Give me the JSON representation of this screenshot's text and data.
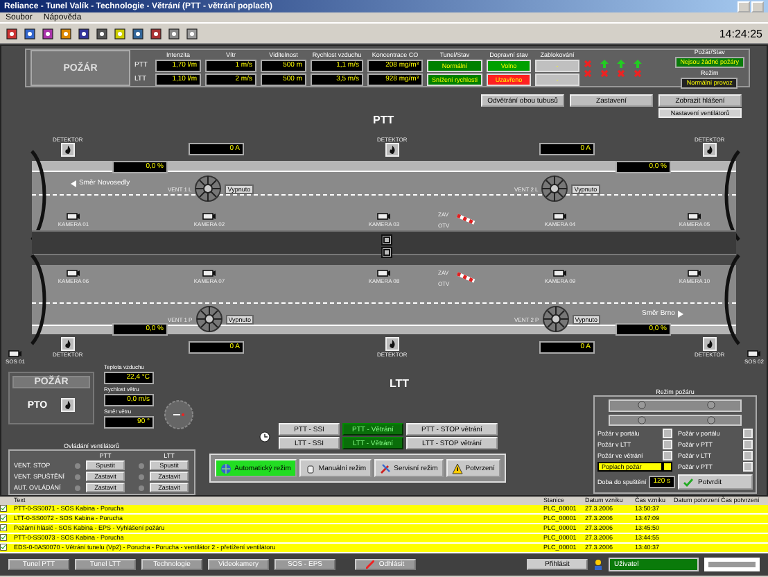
{
  "window": {
    "title": "Reliance - Tunel Valík - Technologie - Větrání (PTT - větrání poplach)"
  },
  "menu": [
    "Soubor",
    "Nápověda"
  ],
  "toolbar": {
    "time": "14:24:25"
  },
  "status_panel": {
    "fire_label": "POŽÁR",
    "headers": [
      "Intenzita",
      "Vítr",
      "Viditelnost",
      "Rychlost vzduchu",
      "Koncentrace CO",
      "Tunel/Stav",
      "Dopravní stav",
      "Zablokování"
    ],
    "rows": [
      {
        "tube": "PTT",
        "cells": [
          {
            "kind": "display",
            "text": "1,70 l/m"
          },
          {
            "kind": "display",
            "text": "1 m/s"
          },
          {
            "kind": "display",
            "text": "500 m"
          },
          {
            "kind": "display",
            "text": "1,1 m/s"
          },
          {
            "kind": "display",
            "text": "208 mg/m³"
          },
          {
            "kind": "status",
            "text": "Normální",
            "color": "#008000"
          },
          {
            "kind": "status",
            "text": "Volno",
            "color": "#00a000"
          },
          {
            "kind": "status",
            "text": "-",
            "color": "#c0c0c0"
          }
        ],
        "signals": [
          {
            "fault": true
          },
          {
            "fault": false
          },
          {
            "fault": false
          },
          {
            "fault": false
          }
        ]
      },
      {
        "tube": "LTT",
        "cells": [
          {
            "kind": "display",
            "text": "1,10 l/m"
          },
          {
            "kind": "display",
            "text": "2 m/s"
          },
          {
            "kind": "display",
            "text": "500 m"
          },
          {
            "kind": "display",
            "text": "3,5 m/s"
          },
          {
            "kind": "display",
            "text": "928 mg/m³"
          },
          {
            "kind": "status",
            "text": "Snížení rychlosti",
            "color": "#008000"
          },
          {
            "kind": "status",
            "text": "Uzavřeno",
            "color": "#ff2020"
          },
          {
            "kind": "status",
            "text": "-",
            "color": "#c0c0c0"
          }
        ],
        "signals": [
          {
            "fault": true
          },
          {
            "fault": true
          },
          {
            "fault": true
          },
          {
            "fault": true
          }
        ]
      }
    ],
    "fire_status": {
      "label": "Požár/Stav",
      "text": "Nejsou žádné požáry"
    },
    "mode": {
      "label": "Režim",
      "text": "Normální provoz"
    }
  },
  "actions": [
    "Odvětrání obou tubusů",
    "Zastavení",
    "Zobrazit hlášení",
    "Nastavení ventilátorů"
  ],
  "tunnels": [
    {
      "name": "PTT",
      "detectors": [
        "DETEKTOR",
        "DETEKTOR",
        "DETEKTOR"
      ],
      "currents": [
        "0 A",
        "0 A"
      ],
      "opacity": [
        "0,0 %",
        "0,0 %"
      ],
      "direction": "Směr Novosedly",
      "fans": [
        {
          "label": "VENT 1 L",
          "state": "Vypnuto"
        },
        {
          "label": "VENT 2 L",
          "state": "Vypnuto"
        }
      ],
      "cameras": [
        "KAMERA 01",
        "KAMERA 02",
        "KAMERA 03",
        "KAMERA 04",
        "KAMERA 05"
      ],
      "barrier_labels": [
        "ZAV",
        "OTV"
      ]
    },
    {
      "name": "LTT",
      "detectors": [
        "DETEKTOR",
        "DETEKTOR",
        "DETEKTOR"
      ],
      "currents": [
        "0 A",
        "0 A"
      ],
      "opacity": [
        "0,0 %",
        "0,0 %"
      ],
      "direction": "Směr Brno",
      "fans": [
        {
          "label": "VENT 1 P",
          "state": "Vypnuto"
        },
        {
          "label": "VENT 2 P",
          "state": "Vypnuto"
        }
      ],
      "cameras": [
        "KAMERA 06",
        "KAMERA 07",
        "KAMERA 08",
        "KAMERA 09",
        "KAMERA 10"
      ],
      "barrier_labels": [
        "ZAV",
        "OTV"
      ]
    }
  ],
  "exits": [
    "SOS 01",
    "SOS 02"
  ],
  "fire_box": {
    "title": "POŽÁR",
    "zone": "PTO"
  },
  "weather": [
    {
      "label": "Teplota vzduchu",
      "value": "22,4 °C"
    },
    {
      "label": "Rychlost větru",
      "value": "0,0 m/s"
    },
    {
      "label": "Směr větru",
      "value": "90 °"
    }
  ],
  "fan_control": {
    "title": "Ovládání ventilátorů",
    "columns": [
      "PTT",
      "LTT"
    ],
    "rows": [
      {
        "label": "VENT. STOP",
        "buttons": [
          "Spustit",
          "Spustit"
        ]
      },
      {
        "label": "VENT. SPUŠTĚNÍ",
        "buttons": [
          "Zastavit",
          "Zastavit"
        ]
      },
      {
        "label": "AUT. OVLÁDÁNÍ",
        "buttons": [
          "Zastavit",
          "Zastavit"
        ]
      }
    ]
  },
  "commands": [
    {
      "label": "PTT - SSI",
      "selected": false
    },
    {
      "label": "PTT - Větrání",
      "selected": true
    },
    {
      "label": "PTT - STOP větrání",
      "selected": false
    },
    {
      "label": "LTT - SSI",
      "selected": false
    },
    {
      "label": "LTT - Větrání",
      "selected": true
    },
    {
      "label": "LTT - STOP větrání",
      "selected": false
    }
  ],
  "modes": [
    {
      "label": "Automatický režim",
      "selected": true
    },
    {
      "label": "Manuální režim",
      "selected": false
    },
    {
      "label": "Servisní režim",
      "selected": false
    },
    {
      "label": "Potvrzení",
      "selected": false
    }
  ],
  "fire_mode": {
    "title": "Režim požáru",
    "checks": [
      {
        "label": "Požár v portálu",
        "checked": false
      },
      {
        "label": "Požár v portálu",
        "checked": false
      },
      {
        "label": "Požár v LTT",
        "checked": false
      },
      {
        "label": "Požár v PTT",
        "checked": false
      },
      {
        "label": "Požár ve větrání",
        "checked": false
      },
      {
        "label": "Požár v LTT",
        "checked": false
      }
    ],
    "alarm": {
      "label": "Poplach požár",
      "checked": true
    },
    "side_check": {
      "label": "Požár v PTT",
      "checked": false
    },
    "delay": {
      "label": "Doba do spuštění",
      "value": "120 s"
    },
    "confirm": "Potvrdit"
  },
  "alarms": {
    "columns": [
      "Text",
      "Stanice",
      "Datum vzniku",
      "Čas vzniku",
      "Datum potvrzení",
      "Čas potvrzení"
    ],
    "rows": [
      {
        "text": "PTT-0-SS0071 - SOS Kabina - Porucha",
        "station": "PLC_00001",
        "date": "27.3.2006",
        "time": "13:50:37"
      },
      {
        "text": "LTT-0-SS0072 - SOS Kabina - Porucha",
        "station": "PLC_00001",
        "date": "27.3.2006",
        "time": "13:47:09"
      },
      {
        "text": "Požární hlásič - SOS Kabina - EPS - Vyhlášení požáru",
        "station": "PLC_00001",
        "date": "27.3.2006",
        "time": "13:45:50"
      },
      {
        "text": "PTT-0-SS0073 - SOS Kabina - Porucha",
        "station": "PLC_00001",
        "date": "27.3.2006",
        "time": "13:44:55"
      },
      {
        "text": "EDS-0-0AS0070 - Větrání tunelu (Vp2) - Porucha - Porucha - ventilátor 2 - přetížení ventilátoru",
        "station": "PLC_00001",
        "date": "27.3.2006",
        "time": "13:40:37"
      }
    ]
  },
  "bottom_bar": {
    "buttons": [
      "Tunel PTT",
      "Tunel LTT",
      "Technologie",
      "Videokamery",
      "SOS - EPS"
    ],
    "logout": "Odhlásit",
    "login": "Přihlásit",
    "user": "Uživatel"
  }
}
